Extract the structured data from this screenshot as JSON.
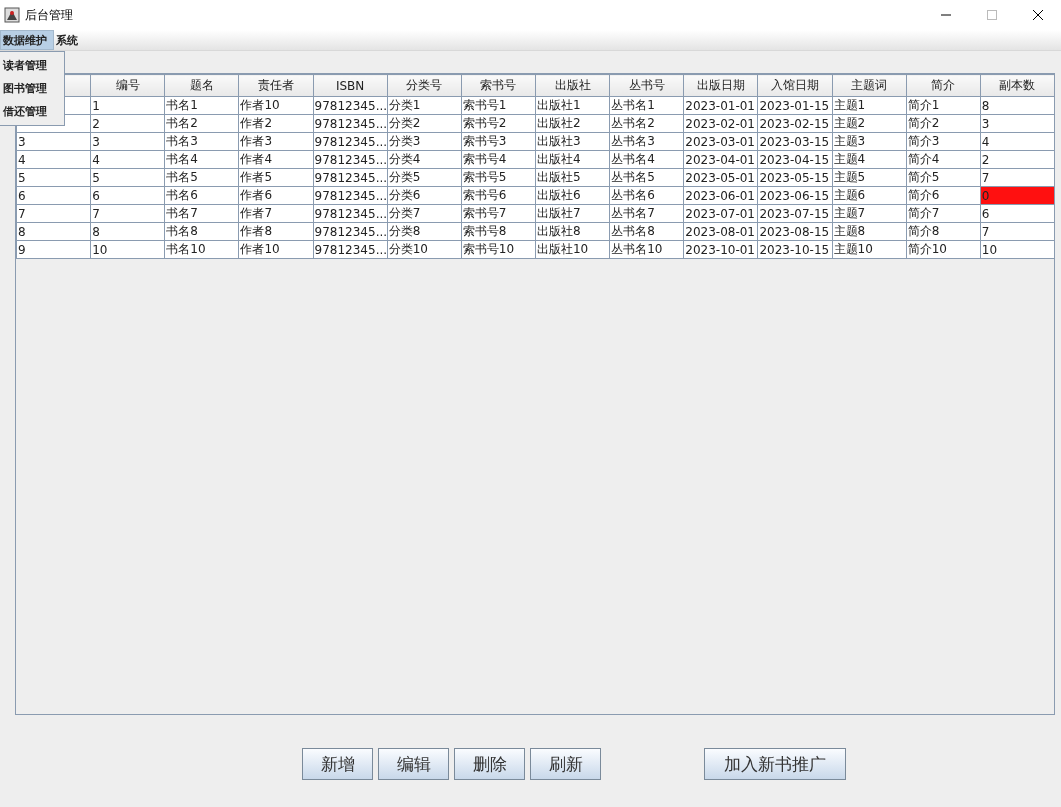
{
  "window": {
    "title": "后台管理"
  },
  "menu_bar": [
    {
      "label": "数据维护",
      "selected": true
    },
    {
      "label": "系统",
      "selected": false
    }
  ],
  "dropdown": [
    "读者管理",
    "图书管理",
    "借还管理"
  ],
  "table": {
    "columns": [
      "编号",
      "题名",
      "责任者",
      "ISBN",
      "分类号",
      "索书号",
      "出版社",
      "丛书号",
      "出版日期",
      "入馆日期",
      "主题词",
      "简介",
      "副本数"
    ],
    "rows": [
      {
        "cells": [
          "1",
          "书名1",
          "作者10",
          "97812345...",
          "分类1",
          "索书号1",
          "出版社1",
          "丛书名1",
          "2023-01-01",
          "2023-01-15",
          "主题1",
          "简介1",
          "8"
        ],
        "highlighted": false
      },
      {
        "cells": [
          "2",
          "书名2",
          "作者2",
          "97812345...",
          "分类2",
          "索书号2",
          "出版社2",
          "丛书名2",
          "2023-02-01",
          "2023-02-15",
          "主题2",
          "简介2",
          "3"
        ],
        "highlighted": false
      },
      {
        "column_1": "3",
        "cells": [
          "3",
          "书名3",
          "作者3",
          "97812345...",
          "分类3",
          "索书号3",
          "出版社3",
          "丛书名3",
          "2023-03-01",
          "2023-03-15",
          "主题3",
          "简介3",
          "4"
        ],
        "highlighted": false
      },
      {
        "column_1": "4",
        "cells": [
          "4",
          "书名4",
          "作者4",
          "97812345...",
          "分类4",
          "索书号4",
          "出版社4",
          "丛书名4",
          "2023-04-01",
          "2023-04-15",
          "主题4",
          "简介4",
          "2"
        ],
        "highlighted": false
      },
      {
        "column_1": "5",
        "cells": [
          "5",
          "书名5",
          "作者5",
          "97812345...",
          "分类5",
          "索书号5",
          "出版社5",
          "丛书名5",
          "2023-05-01",
          "2023-05-15",
          "主题5",
          "简介5",
          "7"
        ],
        "highlighted": false
      },
      {
        "column_1": "6",
        "cells": [
          "6",
          "书名6",
          "作者6",
          "97812345...",
          "分类6",
          "索书号6",
          "出版社6",
          "丛书名6",
          "2023-06-01",
          "2023-06-15",
          "主题6",
          "简介6",
          "0"
        ],
        "highlighted": true
      },
      {
        "column_1": "7",
        "cells": [
          "7",
          "书名7",
          "作者7",
          "97812345...",
          "分类7",
          "索书号7",
          "出版社7",
          "丛书名7",
          "2023-07-01",
          "2023-07-15",
          "主题7",
          "简介7",
          "6"
        ],
        "highlighted": false
      },
      {
        "column_1": "8",
        "cells": [
          "8",
          "书名8",
          "作者8",
          "97812345...",
          "分类8",
          "索书号8",
          "出版社8",
          "丛书名8",
          "2023-08-01",
          "2023-08-15",
          "主题8",
          "简介8",
          "7"
        ],
        "highlighted": false
      },
      {
        "column_1": "9",
        "cells": [
          "10",
          "书名10",
          "作者10",
          "97812345...",
          "分类10",
          "索书号10",
          "出版社10",
          "丛书名10",
          "2023-10-01",
          "2023-10-15",
          "主题10",
          "简介10",
          "10"
        ],
        "highlighted": false
      }
    ]
  },
  "buttons": [
    "新增",
    "编辑",
    "删除",
    "刷新"
  ],
  "promo_button": "加入新书推广"
}
